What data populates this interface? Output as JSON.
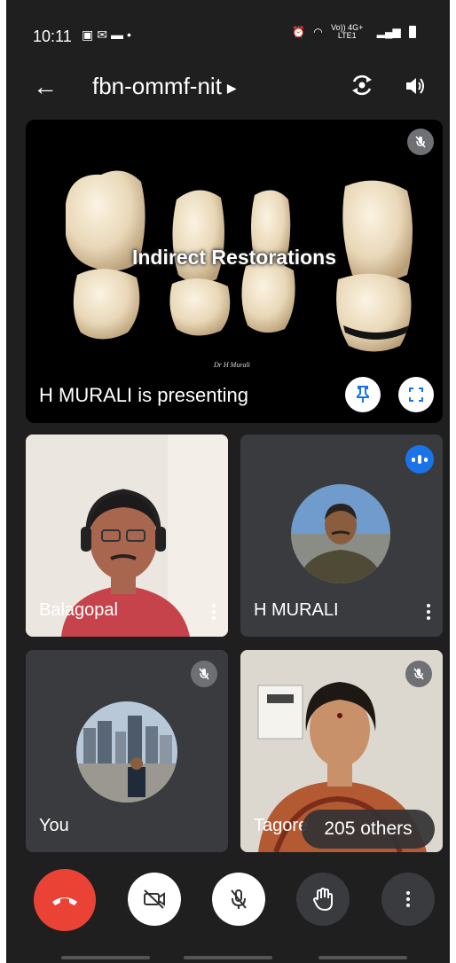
{
  "status_bar": {
    "time": "10:11",
    "left_icons": [
      "image-icon",
      "mail-icon",
      "app-icon"
    ],
    "network_label_top": "Vo)) 4G+",
    "network_label_bottom": "LTE1"
  },
  "meeting": {
    "code": "fbn-ommf-nit"
  },
  "presentation": {
    "slide_title": "Indirect Restorations",
    "slide_signature": "Dr H Murali",
    "caption": "H MURALI is presenting"
  },
  "participants": [
    {
      "name": "Balagopal",
      "muted": false
    },
    {
      "name": "H MURALI",
      "speaking": true
    },
    {
      "name": "You",
      "muted": true
    },
    {
      "name": "Tagore",
      "muted": true
    }
  ],
  "others_count_label": "205 others",
  "controls": [
    {
      "name": "end-call",
      "color": "#ea4335"
    },
    {
      "name": "camera-off"
    },
    {
      "name": "microphone-off"
    },
    {
      "name": "raise-hand"
    },
    {
      "name": "more-options"
    }
  ],
  "colors": {
    "background": "#1f1f1f",
    "tile": "#3a3b3e",
    "accent_blue": "#1a73e8",
    "end_call_red": "#ea4335"
  }
}
